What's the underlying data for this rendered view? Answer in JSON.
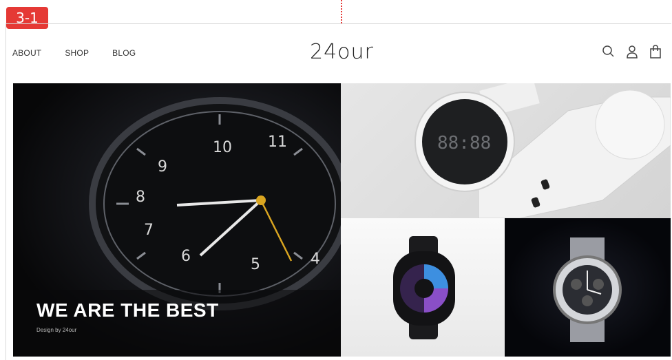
{
  "badge": "3-1",
  "nav": [
    "ABOUT",
    "SHOP",
    "BLOG"
  ],
  "logo": "24our",
  "hero": {
    "title": "WE ARE THE BEST",
    "subtitle": "Design by 24our"
  },
  "watch_display": "88:88",
  "icons": [
    "search-icon",
    "user-icon",
    "shopping-bag-icon"
  ],
  "colors": {
    "badge": "#e53935",
    "text": "#333333",
    "hero_bg": "#0b0b0d"
  }
}
